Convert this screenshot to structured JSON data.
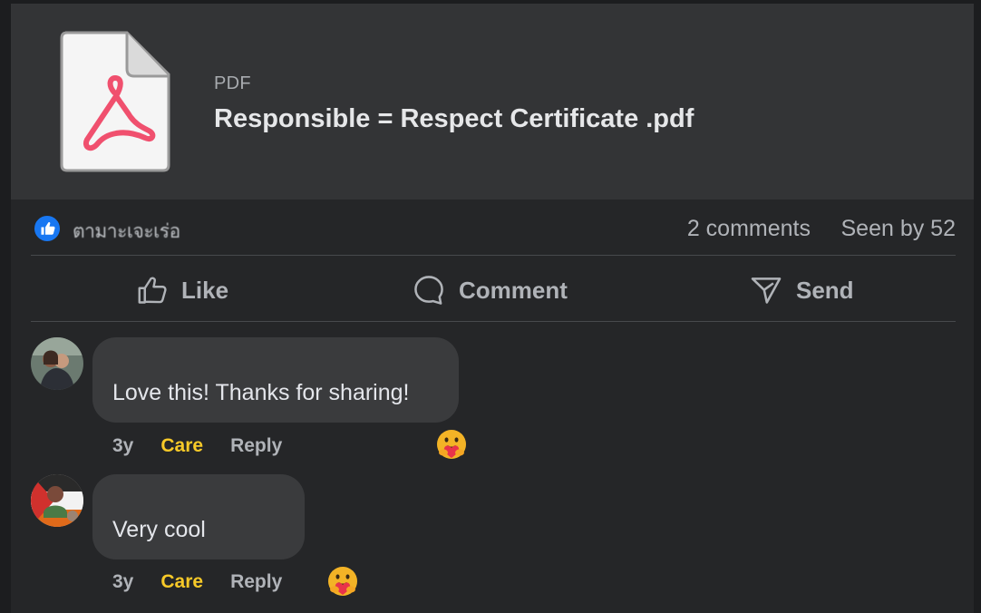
{
  "attachment": {
    "file_type": "PDF",
    "file_name": "Responsible = Respect Certificate .pdf",
    "icon": "pdf-document-icon",
    "accent_color": "#f0506e"
  },
  "reactions": {
    "icon": "like-reaction-icon",
    "reactor_name": "ตามาะเจะเร่อ",
    "comments_count": "2 comments",
    "seen_by": "Seen by 52"
  },
  "actions": [
    {
      "label": "Like",
      "icon": "thumbs-up-icon"
    },
    {
      "label": "Comment",
      "icon": "speech-bubble-icon"
    },
    {
      "label": "Send",
      "icon": "send-icon"
    }
  ],
  "comments": [
    {
      "text": "Love this! Thanks for sharing!",
      "time": "3y",
      "reaction_label": "Care",
      "reply_label": "Reply",
      "reaction_icon": "care-emoji-icon"
    },
    {
      "text": "Very cool",
      "time": "3y",
      "reaction_label": "Care",
      "reply_label": "Reply",
      "reaction_icon": "care-emoji-icon"
    }
  ]
}
